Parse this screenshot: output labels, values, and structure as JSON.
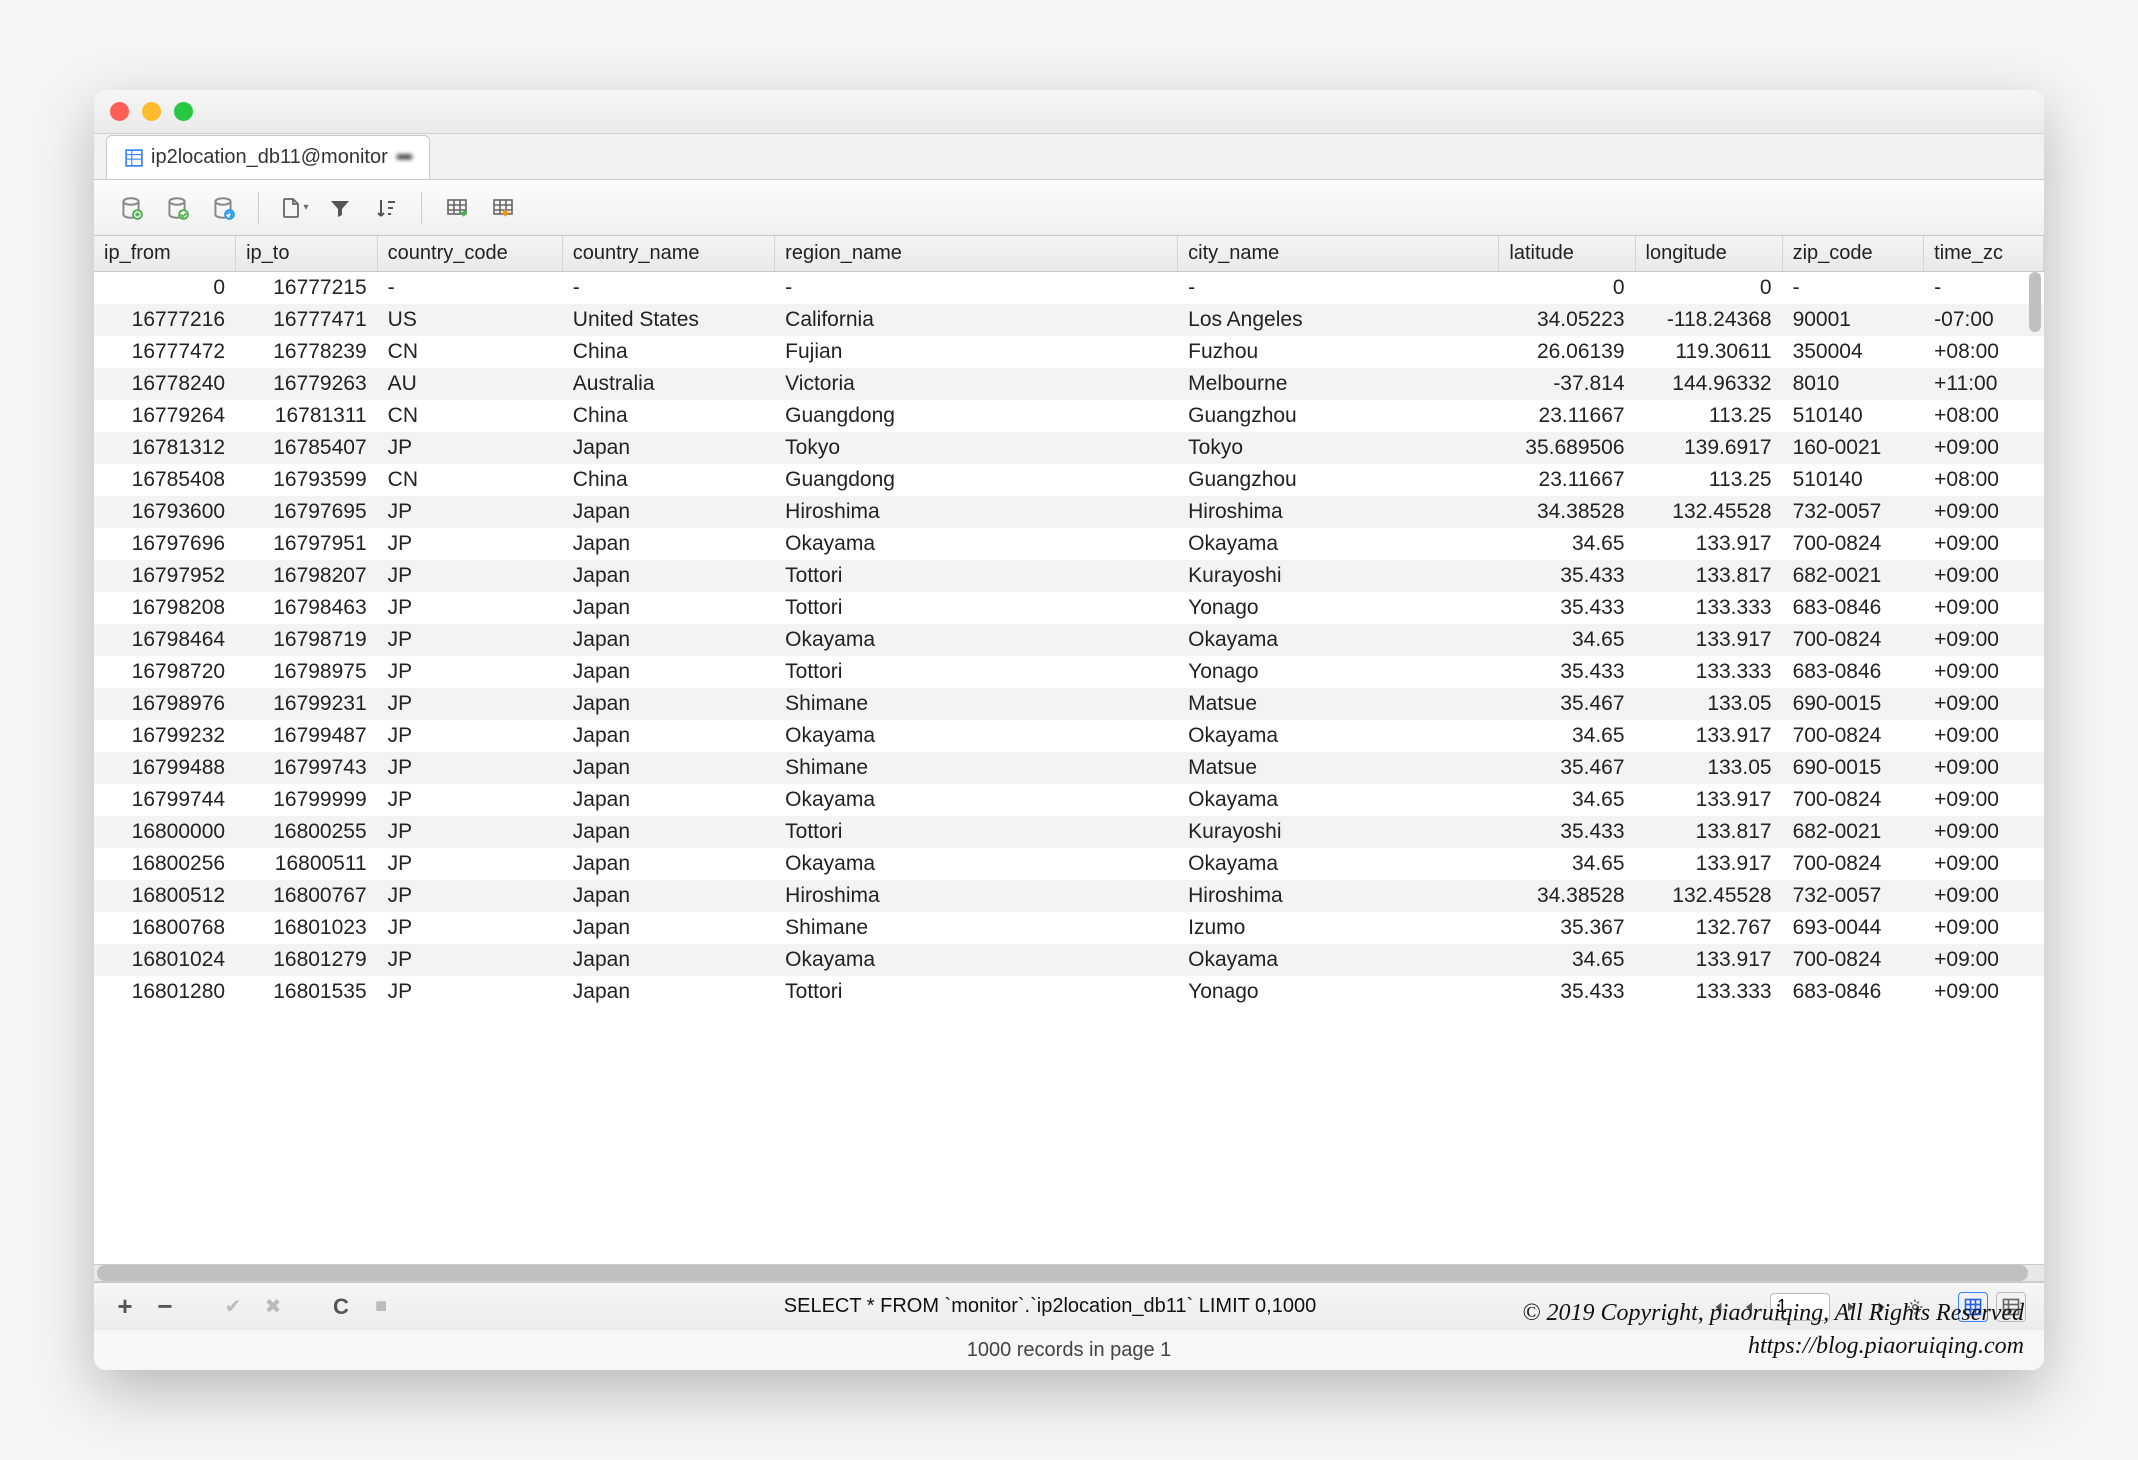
{
  "tab": {
    "title": "ip2location_db11@monitor"
  },
  "columns": [
    "ip_from",
    "ip_to",
    "country_code",
    "country_name",
    "region_name",
    "city_name",
    "latitude",
    "longitude",
    "zip_code",
    "time_zc"
  ],
  "col_align": [
    "num",
    "num",
    "",
    "",
    "",
    "",
    "num",
    "num",
    "",
    ""
  ],
  "rows": [
    [
      "0",
      "16777215",
      "-",
      "-",
      "-",
      "-",
      "0",
      "0",
      "-",
      "-"
    ],
    [
      "16777216",
      "16777471",
      "US",
      "United States",
      "California",
      "Los Angeles",
      "34.05223",
      "-118.24368",
      "90001",
      "-07:00"
    ],
    [
      "16777472",
      "16778239",
      "CN",
      "China",
      "Fujian",
      "Fuzhou",
      "26.06139",
      "119.30611",
      "350004",
      "+08:00"
    ],
    [
      "16778240",
      "16779263",
      "AU",
      "Australia",
      "Victoria",
      "Melbourne",
      "-37.814",
      "144.96332",
      "8010",
      "+11:00"
    ],
    [
      "16779264",
      "16781311",
      "CN",
      "China",
      "Guangdong",
      "Guangzhou",
      "23.11667",
      "113.25",
      "510140",
      "+08:00"
    ],
    [
      "16781312",
      "16785407",
      "JP",
      "Japan",
      "Tokyo",
      "Tokyo",
      "35.689506",
      "139.6917",
      "160-0021",
      "+09:00"
    ],
    [
      "16785408",
      "16793599",
      "CN",
      "China",
      "Guangdong",
      "Guangzhou",
      "23.11667",
      "113.25",
      "510140",
      "+08:00"
    ],
    [
      "16793600",
      "16797695",
      "JP",
      "Japan",
      "Hiroshima",
      "Hiroshima",
      "34.38528",
      "132.45528",
      "732-0057",
      "+09:00"
    ],
    [
      "16797696",
      "16797951",
      "JP",
      "Japan",
      "Okayama",
      "Okayama",
      "34.65",
      "133.917",
      "700-0824",
      "+09:00"
    ],
    [
      "16797952",
      "16798207",
      "JP",
      "Japan",
      "Tottori",
      "Kurayoshi",
      "35.433",
      "133.817",
      "682-0021",
      "+09:00"
    ],
    [
      "16798208",
      "16798463",
      "JP",
      "Japan",
      "Tottori",
      "Yonago",
      "35.433",
      "133.333",
      "683-0846",
      "+09:00"
    ],
    [
      "16798464",
      "16798719",
      "JP",
      "Japan",
      "Okayama",
      "Okayama",
      "34.65",
      "133.917",
      "700-0824",
      "+09:00"
    ],
    [
      "16798720",
      "16798975",
      "JP",
      "Japan",
      "Tottori",
      "Yonago",
      "35.433",
      "133.333",
      "683-0846",
      "+09:00"
    ],
    [
      "16798976",
      "16799231",
      "JP",
      "Japan",
      "Shimane",
      "Matsue",
      "35.467",
      "133.05",
      "690-0015",
      "+09:00"
    ],
    [
      "16799232",
      "16799487",
      "JP",
      "Japan",
      "Okayama",
      "Okayama",
      "34.65",
      "133.917",
      "700-0824",
      "+09:00"
    ],
    [
      "16799488",
      "16799743",
      "JP",
      "Japan",
      "Shimane",
      "Matsue",
      "35.467",
      "133.05",
      "690-0015",
      "+09:00"
    ],
    [
      "16799744",
      "16799999",
      "JP",
      "Japan",
      "Okayama",
      "Okayama",
      "34.65",
      "133.917",
      "700-0824",
      "+09:00"
    ],
    [
      "16800000",
      "16800255",
      "JP",
      "Japan",
      "Tottori",
      "Kurayoshi",
      "35.433",
      "133.817",
      "682-0021",
      "+09:00"
    ],
    [
      "16800256",
      "16800511",
      "JP",
      "Japan",
      "Okayama",
      "Okayama",
      "34.65",
      "133.917",
      "700-0824",
      "+09:00"
    ],
    [
      "16800512",
      "16800767",
      "JP",
      "Japan",
      "Hiroshima",
      "Hiroshima",
      "34.38528",
      "132.45528",
      "732-0057",
      "+09:00"
    ],
    [
      "16800768",
      "16801023",
      "JP",
      "Japan",
      "Shimane",
      "Izumo",
      "35.367",
      "132.767",
      "693-0044",
      "+09:00"
    ],
    [
      "16801024",
      "16801279",
      "JP",
      "Japan",
      "Okayama",
      "Okayama",
      "34.65",
      "133.917",
      "700-0824",
      "+09:00"
    ],
    [
      "16801280",
      "16801535",
      "JP",
      "Japan",
      "Tottori",
      "Yonago",
      "35.433",
      "133.333",
      "683-0846",
      "+09:00"
    ]
  ],
  "footer": {
    "query": "SELECT * FROM `monitor`.`ip2location_db11` LIMIT 0,1000",
    "page": "1",
    "status": "1000 records in page 1"
  },
  "credits": {
    "line1": "© 2019 Copyright,  piaoruiqing,  All Rights Reserved",
    "line2": "https://blog.piaoruiqing.com"
  }
}
